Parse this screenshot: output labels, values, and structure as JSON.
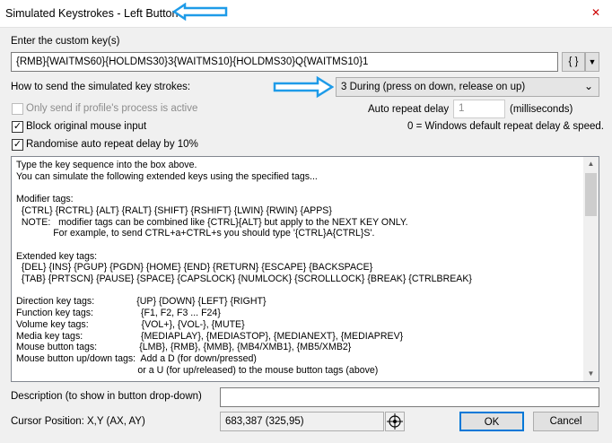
{
  "window": {
    "title": "Simulated Keystrokes - Left Button",
    "close_glyph": "✕"
  },
  "custom_key": {
    "label": "Enter the custom key(s)",
    "value": "{RMB}{WAITMS60}{HOLDMS30}3{WAITMS10}{HOLDMS30}Q{WAITMS10}1",
    "tags_button": "{ }",
    "dropdown_glyph": "▼"
  },
  "send_method": {
    "label": "How to send the simulated key strokes:",
    "selected": "3 During (press on down, release on up)",
    "dropdown_glyph": "⌄"
  },
  "options": {
    "only_profile": {
      "label": "Only send if profile's process is active",
      "checked": false,
      "disabled": true
    },
    "block_mouse": {
      "label": "Block original mouse input",
      "checked": true
    },
    "randomise": {
      "label": "Randomise auto repeat delay by 10%",
      "checked": true
    },
    "check_glyph": "✓"
  },
  "auto_repeat": {
    "label": "Auto repeat delay",
    "value": "1",
    "unit": "(milliseconds)",
    "note": "0 = Windows default repeat delay & speed."
  },
  "help": {
    "text": "Type the key sequence into the box above.\nYou can simulate the following extended keys using the specified tags...\n\nModifier tags:\n  {CTRL} {RCTRL} {ALT} {RALT} {SHIFT} {RSHIFT} {LWIN} {RWIN} {APPS}\n  NOTE:   modifier tags can be combined like {CTRL}{ALT} but apply to the NEXT KEY ONLY.\n              For example, to send CTRL+a+CTRL+s you should type '{CTRL}A{CTRL}S'.\n\nExtended key tags:\n  {DEL} {INS} {PGUP} {PGDN} {HOME} {END} {RETURN} {ESCAPE} {BACKSPACE}\n  {TAB} {PRTSCN} {PAUSE} {SPACE} {CAPSLOCK} {NUMLOCK} {SCROLLLOCK} {BREAK} {CTRLBREAK}\n\nDirection key tags:                {UP} {DOWN} {LEFT} {RIGHT}\nFunction key tags:                  {F1, F2, F3 ... F24}\nVolume key tags:                    {VOL+}, {VOL-}, {MUTE}\nMedia key tags:                      {MEDIAPLAY}, {MEDIASTOP}, {MEDIANEXT}, {MEDIAPREV}\nMouse button tags:                {LMB}, {RMB}, {MMB}, {MB4/XMB1}, {MB5/XMB2}\nMouse button up/down tags:  Add a D (for down/pressed)\n                                              or a U (for up/released) to the mouse button tags (above)",
    "scroll_up": "▲",
    "scroll_down": "▼"
  },
  "description": {
    "label": "Description (to show in button drop-down)",
    "value": ""
  },
  "cursor": {
    "label": "Cursor Position: X,Y (AX, AY)",
    "value": "683,387 (325,95)",
    "icon": "crosshair-icon"
  },
  "buttons": {
    "ok": "OK",
    "cancel": "Cancel"
  },
  "colors": {
    "annotation_arrow": "#1e9be8",
    "ok_border": "#0078d7"
  }
}
